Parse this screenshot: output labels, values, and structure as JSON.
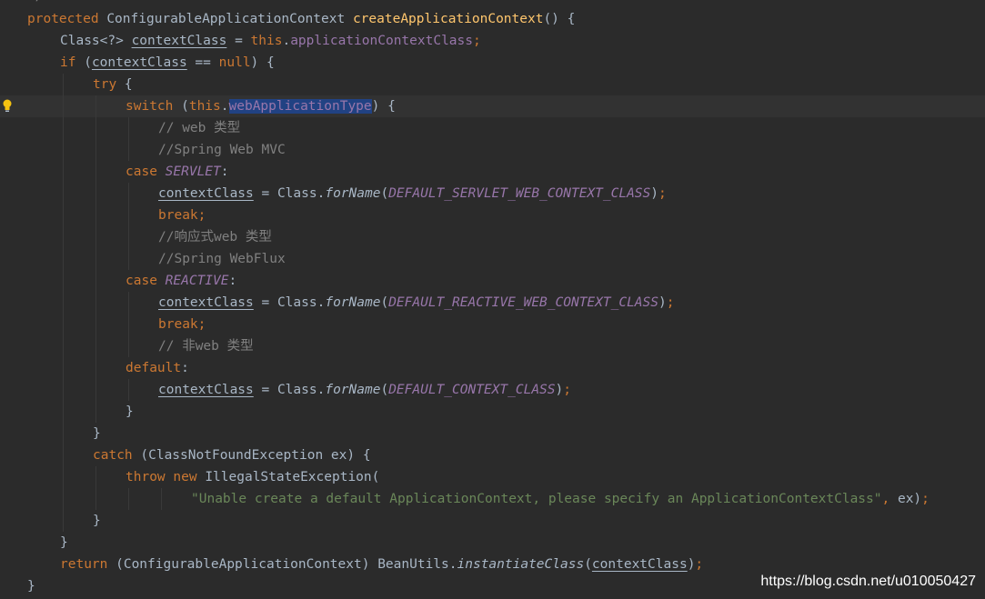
{
  "editor": {
    "top_fragment": "*/",
    "lines": [
      {
        "indent": 0,
        "tokens": [
          [
            "kw",
            "protected "
          ],
          [
            "",
            "ConfigurableApplicationContext "
          ],
          [
            "fn",
            "createApplicationContext"
          ],
          [
            "",
            "() {"
          ]
        ]
      },
      {
        "indent": 1,
        "tokens": [
          [
            "",
            "Class<?> "
          ],
          [
            "var",
            "contextClass"
          ],
          [
            "",
            " = "
          ],
          [
            "kw",
            "this"
          ],
          [
            "",
            "."
          ],
          [
            "fld",
            "applicationContextClass"
          ],
          [
            "kw",
            ";"
          ]
        ]
      },
      {
        "indent": 1,
        "tokens": [
          [
            "kw",
            "if "
          ],
          [
            "",
            "("
          ],
          [
            "var",
            "contextClass"
          ],
          [
            "",
            " == "
          ],
          [
            "kw",
            "null"
          ],
          [
            "",
            ") {"
          ]
        ]
      },
      {
        "indent": 2,
        "tokens": [
          [
            "kw",
            "try "
          ],
          [
            "",
            "{"
          ]
        ]
      },
      {
        "indent": 3,
        "current": true,
        "bulb": true,
        "tokens": [
          [
            "kw",
            "switch "
          ],
          [
            "",
            "("
          ],
          [
            "kw",
            "this"
          ],
          [
            "",
            "."
          ],
          [
            "fld hl",
            "webApplicationType"
          ],
          [
            "",
            ") {"
          ]
        ]
      },
      {
        "indent": 4,
        "tokens": [
          [
            "cm",
            "// web 类型"
          ]
        ]
      },
      {
        "indent": 4,
        "tokens": [
          [
            "cm",
            "//Spring Web MVC"
          ]
        ]
      },
      {
        "indent": 3,
        "tokens": [
          [
            "kw",
            "case "
          ],
          [
            "ufld",
            "SERVLET"
          ],
          [
            "",
            ":"
          ]
        ]
      },
      {
        "indent": 4,
        "tokens": [
          [
            "var",
            "contextClass"
          ],
          [
            "",
            " = Class."
          ],
          [
            "it",
            "forName"
          ],
          [
            "",
            "("
          ],
          [
            "ufld",
            "DEFAULT_SERVLET_WEB_CONTEXT_CLASS"
          ],
          [
            "",
            ")"
          ],
          [
            "kw",
            ";"
          ]
        ]
      },
      {
        "indent": 4,
        "tokens": [
          [
            "kw",
            "break;"
          ]
        ]
      },
      {
        "indent": 4,
        "tokens": [
          [
            "cm",
            "//响应式web 类型"
          ]
        ]
      },
      {
        "indent": 4,
        "tokens": [
          [
            "cm",
            "//Spring WebFlux"
          ]
        ]
      },
      {
        "indent": 3,
        "tokens": [
          [
            "kw",
            "case "
          ],
          [
            "ufld",
            "REACTIVE"
          ],
          [
            "",
            ":"
          ]
        ]
      },
      {
        "indent": 4,
        "tokens": [
          [
            "var",
            "contextClass"
          ],
          [
            "",
            " = Class."
          ],
          [
            "it",
            "forName"
          ],
          [
            "",
            "("
          ],
          [
            "ufld",
            "DEFAULT_REACTIVE_WEB_CONTEXT_CLASS"
          ],
          [
            "",
            ")"
          ],
          [
            "kw",
            ";"
          ]
        ]
      },
      {
        "indent": 4,
        "tokens": [
          [
            "kw",
            "break;"
          ]
        ]
      },
      {
        "indent": 4,
        "tokens": [
          [
            "cm",
            "// 非web 类型"
          ]
        ]
      },
      {
        "indent": 3,
        "tokens": [
          [
            "kw",
            "default"
          ],
          [
            "",
            ":"
          ]
        ]
      },
      {
        "indent": 4,
        "tokens": [
          [
            "var",
            "contextClass"
          ],
          [
            "",
            " = Class."
          ],
          [
            "it",
            "forName"
          ],
          [
            "",
            "("
          ],
          [
            "ufld",
            "DEFAULT_CONTEXT_CLASS"
          ],
          [
            "",
            ")"
          ],
          [
            "kw",
            ";"
          ]
        ]
      },
      {
        "indent": 3,
        "tokens": [
          [
            "",
            "}"
          ]
        ]
      },
      {
        "indent": 2,
        "tokens": [
          [
            "",
            "}"
          ]
        ]
      },
      {
        "indent": 2,
        "tokens": [
          [
            "kw",
            "catch "
          ],
          [
            "",
            "(ClassNotFoundException ex) {"
          ]
        ]
      },
      {
        "indent": 3,
        "tokens": [
          [
            "kw",
            "throw new "
          ],
          [
            "",
            "IllegalStateException("
          ]
        ]
      },
      {
        "indent": 5,
        "tokens": [
          [
            "str",
            "\"Unable create a default ApplicationContext, please specify an ApplicationContextClass\""
          ],
          [
            "kw",
            ", "
          ],
          [
            "",
            "ex)"
          ],
          [
            "kw",
            ";"
          ]
        ]
      },
      {
        "indent": 2,
        "tokens": [
          [
            "",
            "}"
          ]
        ]
      },
      {
        "indent": 1,
        "tokens": [
          [
            "",
            "}"
          ]
        ]
      },
      {
        "indent": 1,
        "tokens": [
          [
            "kw",
            "return "
          ],
          [
            "",
            "(ConfigurableApplicationContext) BeanUtils."
          ],
          [
            "it",
            "instantiateClass"
          ],
          [
            "",
            "("
          ],
          [
            "var",
            "contextClass"
          ],
          [
            "",
            ")"
          ],
          [
            "kw",
            ";"
          ]
        ]
      },
      {
        "indent": 0,
        "tokens": [
          [
            "",
            "}"
          ]
        ]
      }
    ]
  },
  "watermark": "https://blog.csdn.net/u010050427",
  "icons": {
    "intention": "lightbulb-icon"
  },
  "colors": {
    "background": "#2b2b2b",
    "keyword": "#cc7832",
    "method": "#ffc66d",
    "field": "#9876aa",
    "comment": "#808080",
    "string": "#6a8759",
    "text": "#a9b7c6",
    "selection": "#214283"
  }
}
